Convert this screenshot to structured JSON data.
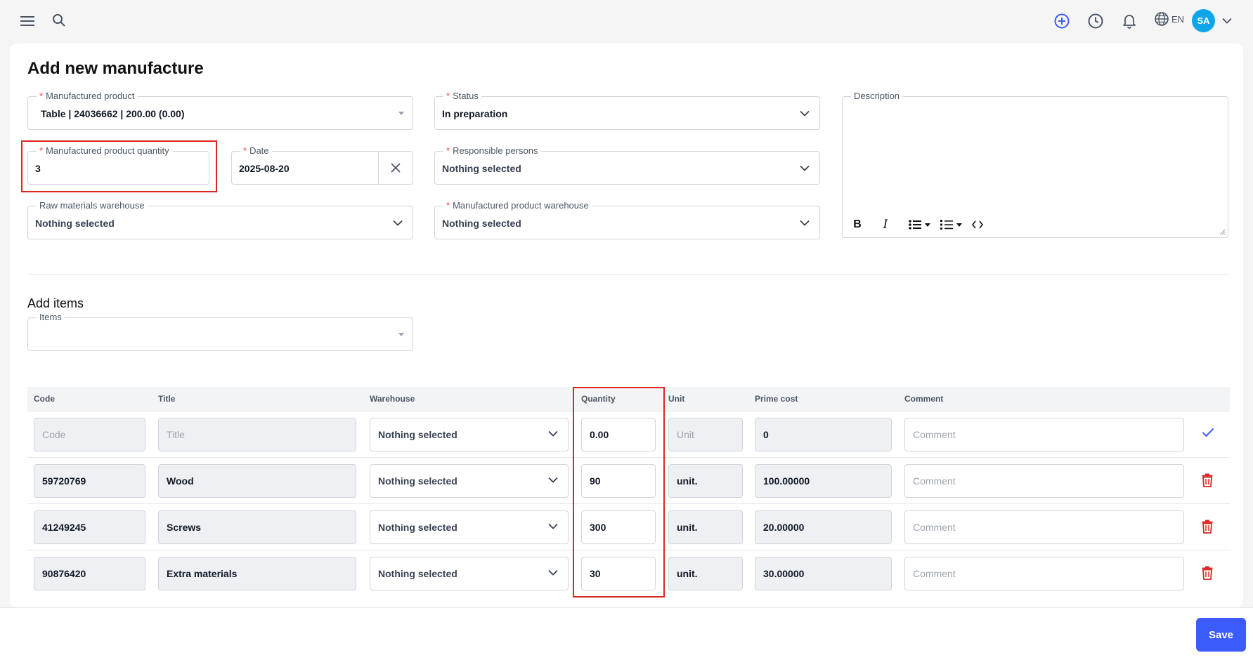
{
  "header": {
    "icons": [
      "menu-icon",
      "search-icon",
      "add-circle-icon",
      "history-icon",
      "bell-icon",
      "globe-icon",
      "chevron-down-icon"
    ],
    "language": "EN",
    "avatar_initials": "SA"
  },
  "page": {
    "title": "Add new manufacture"
  },
  "form": {
    "manufactured_product": {
      "label": "Manufactured product",
      "value": "Table | 24036662 | 200.00 (0.00)"
    },
    "status": {
      "label": "Status",
      "value": "In preparation"
    },
    "description": {
      "label": "Description"
    },
    "quantity": {
      "label": "Manufactured product quantity",
      "value": "3"
    },
    "date": {
      "label": "Date",
      "value": "2025-08-20"
    },
    "responsible": {
      "label": "Responsible persons",
      "value": "Nothing selected"
    },
    "raw_warehouse": {
      "label": "Raw materials warehouse",
      "value": "Nothing selected"
    },
    "product_warehouse": {
      "label": "Manufactured product warehouse",
      "value": "Nothing selected"
    }
  },
  "items_section": {
    "title": "Add items",
    "items_label": "Items"
  },
  "table": {
    "headers": {
      "code": "Code",
      "title": "Title",
      "warehouse": "Warehouse",
      "quantity": "Quantity",
      "unit": "Unit",
      "prime_cost": "Prime cost",
      "comment": "Comment"
    },
    "new_row": {
      "code_placeholder": "Code",
      "title_placeholder": "Title",
      "warehouse": "Nothing selected",
      "quantity": "0.00",
      "unit_placeholder": "Unit",
      "prime_cost": "0",
      "comment_placeholder": "Comment"
    },
    "rows": [
      {
        "code": "59720769",
        "title": "Wood",
        "warehouse": "Nothing selected",
        "quantity": "90",
        "unit": "unit.",
        "prime_cost": "100.00000",
        "comment_placeholder": "Comment"
      },
      {
        "code": "41249245",
        "title": "Screws",
        "warehouse": "Nothing selected",
        "quantity": "300",
        "unit": "unit.",
        "prime_cost": "20.00000",
        "comment_placeholder": "Comment"
      },
      {
        "code": "90876420",
        "title": "Extra materials",
        "warehouse": "Nothing selected",
        "quantity": "30",
        "unit": "unit.",
        "prime_cost": "30.00000",
        "comment_placeholder": "Comment"
      }
    ]
  },
  "footer": {
    "save_label": "Save"
  },
  "colors": {
    "accent": "#3b5bfd",
    "danger": "#dc2626",
    "avatar": "#0ea5e9"
  }
}
